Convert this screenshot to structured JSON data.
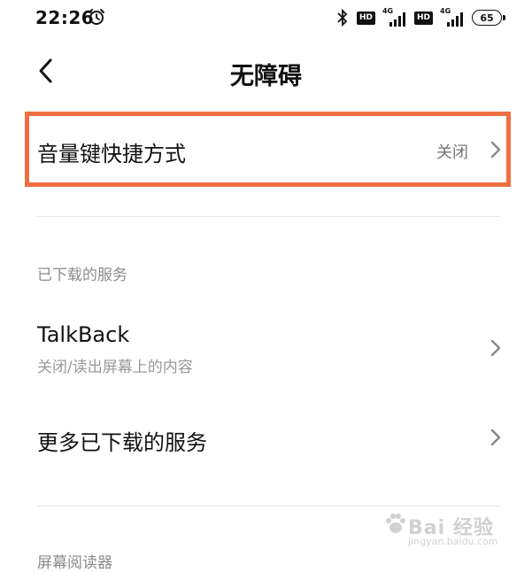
{
  "status_bar": {
    "time": "22:26",
    "hd1": "HD",
    "net1": "4G",
    "hd2": "HD",
    "net2": "4G",
    "battery": "65"
  },
  "header": {
    "title": "无障碍"
  },
  "volume_shortcut": {
    "title": "音量键快捷方式",
    "value": "关闭"
  },
  "sections": {
    "downloaded": "已下载的服务",
    "screen_reader": "屏幕阅读器"
  },
  "talkback": {
    "title": "TalkBack",
    "subtitle": "关闭/读出屏幕上的内容"
  },
  "more_services": {
    "title": "更多已下载的服务"
  },
  "watermark": {
    "text": "Bai 经验",
    "sub": "jingyan.baidu.com"
  },
  "colors": {
    "highlight": "#ee7042"
  }
}
